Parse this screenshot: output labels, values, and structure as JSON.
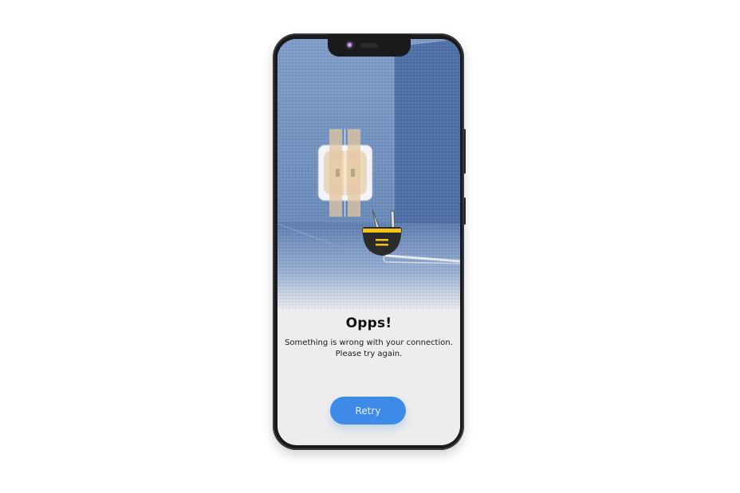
{
  "error": {
    "title": "Opps!",
    "message_line1": "Something is wrong with your connection.",
    "message_line2": "Please try again."
  },
  "actions": {
    "retry_label": "Retry"
  },
  "colors": {
    "accent": "#3d8ae8",
    "illustration_wall": "#6f8fbd",
    "illustration_shadow": "#4b6aa0",
    "plug": "#2b2b2b",
    "plug_band": "#f4c21b",
    "tape": "#e8c69a"
  },
  "icons": {
    "illustration": "unplugged-socket-illustration",
    "plug": "plug-icon",
    "socket": "power-socket-icon"
  }
}
